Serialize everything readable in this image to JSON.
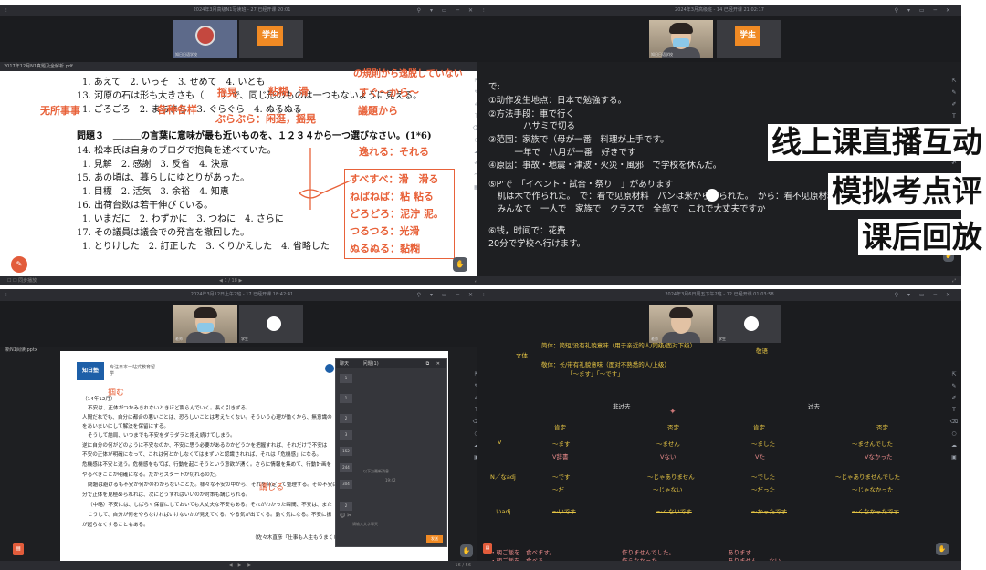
{
  "overlay": {
    "line1": "线上课直播互动",
    "line2": "模拟考点评",
    "line3": "课后回放"
  },
  "panel1": {
    "window_title": "2024年3月高级N1写读班 - 27  已经开课 20:01",
    "student_tile": "学生",
    "teacher_caption": "知日日语学校",
    "file_name": "2017年12月N1真题及全解析.pdf",
    "lines": [
      "1. あえて　2. いっそ　3. せめて　4. いとも",
      "13. 河原の石は形も大きさも（　　）で、同じ形のものは一つもないように見える。",
      "1. ごろごろ　2. まちまち　3. ぐらぐら　4. ぬるぬる",
      "問題３　＿＿＿の言葉に意味が最も近いものを、１２３４から一つ選びなさい。(1*6)",
      "14. 松本氏は自身のブログで抱負を述べていた。",
      "1. 見解　2. 感謝　3. 反省　4. 決意",
      "15. あの頃は、暮らしにゆとりがあった。",
      "1. 目標　2. 活気　3. 余裕　4. 知恵",
      "16. 出荷台数は若干伸びている。",
      "1. いまだに　2. わずかに　3. つねに　4. さらに",
      "17. その議員は議会での発言を撤回した。",
      "1. とりけした　2. 訂正した　3. くりかえした　4. 省略した"
    ],
    "notes": {
      "top_right": "の規則から逸脱していない",
      "n1": "揺晃",
      "n2": "粘糊，滑",
      "n3": "すぐ～から～",
      "n4": "各种各样",
      "n5": "議題から",
      "n6": "无所事事",
      "n7": "ぶらぶら：闲逛，摇晃",
      "n8": "逸れる：それる",
      "box": [
        "すべすべ：滑　滑る",
        "ねばねば：粘 粘る",
        "どろどろ：泥泞 泥。",
        "つるつる：光滑",
        "ぬるぬる：黏糊"
      ]
    },
    "bottom_status": "同步播放",
    "page": "1 / 18"
  },
  "panel2": {
    "window_title": "2024年3月高级班 - 14  已经开课 21:02:17",
    "student_tile": "学生",
    "teacher_caption": "知日日语学校",
    "lines": [
      "で:",
      "①动作发生地点：日本で勉強する。",
      "②方法手段：車で行く",
      "　　　　ハサミで切る",
      "③范围：家族で（母が一番　料理が上手です。",
      "　　　一年で　八月が一番　好きです",
      "④原因：事故・地震・津波・火災・風邪　で学校を休んだ。",
      "⑤P'で　「イベント・試合・祭り　」があります",
      "　机は木で作られた。　で：看で见原材料　パンは米から作られた。　から：看不见原材料",
      "　みんなで　一人で　家族で　クラスで　全部で　これで大丈夫ですか",
      "⑥钱，时间で：花费",
      "20分で学校へ行けます。"
    ]
  },
  "panel3": {
    "window_title": "2024年3月12日上午2班 - 17  已经开课 18:42:41",
    "teacher_tile": "老师",
    "student_tile": "学生",
    "file_name": "新N1阅读.pptx",
    "brand": "知日塾",
    "brand_sub": "专注日本一站式教育留学",
    "date_line": "（14年12月）",
    "handwrite1": "掴む",
    "handwrite2": "講じる",
    "body": [
      "不安は、正体がつかみきれないときほど膨らんでいく。長く引きずる。",
      "人間だれでも、自分に都合の悪いことは、恐ろしいことは考えたくない。そういう心理が働くから、無意識の",
      "をあいまいにして解決を保留にする。",
      "そうして結局、いつまでも不安をダラダラと抱え続けてしまう。",
      "逆に自分の何がどのように不安なのか、不安に思う必要があるのかどうかを把握すれば、それだけで不安は",
      "不安の正体が明確になって、これは何とかしなくてはまずいと認識されれば、それは「危機感」になる。",
      "危機感は不安と違う。危機感をもてば、行動を起こそうという意欲が湧く。さらに情報を集めて、行動計画を",
      "やるべきことが明確になる。だからスタートが切れるのだ。",
      "問題は避けるも不安が何かのわからないことだ。様々な不安の中から、それを特定して整理する。その不安に",
      "分で正体を見極められれば、次にどうすればいいのか対策も講じられる。",
      "（中略）不安には、しばらく保留にしておいても大丈夫な不安もある。それがわかった瞬間、不安は、また",
      "こうして、自分が何をやらなければいけないかが見えてくる。やる気が出てくる。動く気になる。不安に振",
      "が起らなくすることもある。",
      "（佐々木直彦『仕事も人生もうまくいく整理力』）"
    ],
    "chat_tabs": [
      "聊天",
      "问题(1)"
    ],
    "chat_items": [
      "1",
      "1",
      "2",
      "3",
      "152",
      "244",
      "304",
      "2"
    ],
    "chat_notice": "以下为最新消息",
    "chat_time": "19:42",
    "chat_placeholder": "请输入文字聊天",
    "send": "发送",
    "page": "16 / 56"
  },
  "panel4": {
    "window_title": "2024年3月6日周五下午2班 - 12  已经开课 01:03:58",
    "teacher_tile": "老师",
    "student_tile": "学生",
    "style_label": "文体",
    "plain": "简体：简短/没有礼貌意味（用于亲近的人/同级/面对下级）",
    "polite": "敬体：长/带有礼貌意味（面对不熟悉的人/上级）",
    "polite_forms": "「～ます」「～です」",
    "honorific": "敬语",
    "nonpast": "非过去",
    "past": "过去",
    "affirm": "肯定",
    "neg": "否定",
    "rows": [
      {
        "label": "V",
        "c1": "～ます",
        "c2": "～ません",
        "c3": "～ました",
        "c4": "～ませんでした"
      },
      {
        "label": "",
        "c1": "V辞書",
        "c2": "Vない",
        "c3": "Vた",
        "c4": "Vなかった"
      },
      {
        "label": "N／なadj",
        "c1": "～です",
        "c2": "～じゃありません",
        "c3": "～でした",
        "c4": "～じゃありませんでした"
      },
      {
        "label": "",
        "c1": "～だ",
        "c2": "～じゃない",
        "c3": "～だった",
        "c4": "～じゃなかった"
      },
      {
        "label": "いadj",
        "c1": "～いです",
        "c2": "～くないです",
        "c3": "～かったです",
        "c4": "～くなかったです"
      }
    ],
    "ex1a": "・朝ご飯を　食べます。",
    "ex1b": "作りませんでした。",
    "ex1c": "あります",
    "ex2a": "・朝ご飯を　食べる。",
    "ex2b": "作らなかった。",
    "ex2c": "ありません　　ない"
  },
  "colors": {
    "accent_orange": "#f08a24",
    "annotation_red": "#e8623a",
    "text_yellow": "#e6c544"
  }
}
